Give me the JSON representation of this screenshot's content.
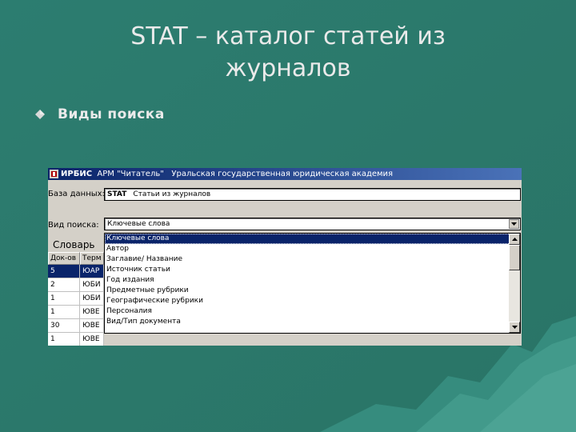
{
  "slide": {
    "title_line1": "STAT – каталог статей  из",
    "title_line2": "журналов",
    "bullet": "Виды поиска",
    "colors": {
      "background": "#2f8072",
      "text": "#eaeaea",
      "bullet_icon": "#d8d8d8"
    }
  },
  "window": {
    "title_app": "ИРБИС",
    "title_module": "АРМ \"Читатель\"",
    "title_org": "Уральская государственная юридическая академия",
    "titlebar_color": "#0a246a",
    "database_label": "База данных:",
    "database_code": "STAT",
    "database_name": "Статьи из журналов",
    "search_type_label": "Вид поиска:",
    "search_type_value": "Ключевые слова",
    "dictionary_label": "Словарь",
    "table": {
      "headers": [
        "Док-ов",
        "Терм"
      ],
      "rows": [
        [
          "5",
          "ЮАР"
        ],
        [
          "2",
          "ЮБИ"
        ],
        [
          "1",
          "ЮБИ"
        ],
        [
          "1",
          "ЮВЕ"
        ],
        [
          "30",
          "ЮВЕ"
        ],
        [
          "1",
          "ЮВЕ"
        ]
      ]
    },
    "search_options": [
      "Ключевые слова",
      "Автор",
      "Заглавие/ Название",
      "Источник статьи",
      "Год издания",
      "Предметные рубрики",
      "Географические рубрики",
      "Персоналия",
      "Вид/Тип документа"
    ],
    "selected_option_index": 0
  }
}
